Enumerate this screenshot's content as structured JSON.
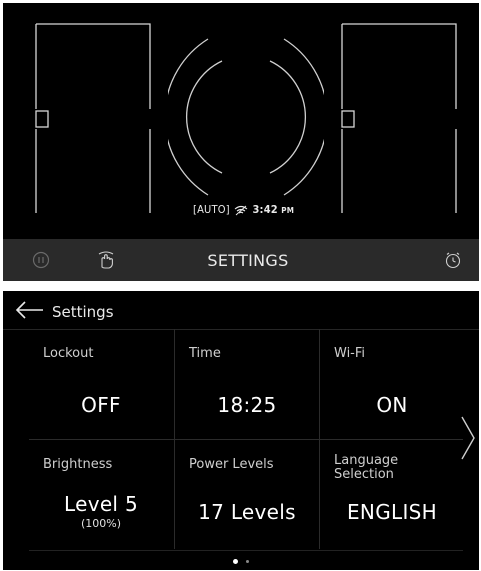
{
  "cooktop": {
    "status": {
      "auto": "AUTO",
      "time": "3:42",
      "ampm": "PM"
    },
    "bar": {
      "settings_label": "SETTINGS"
    }
  },
  "settings_screen": {
    "title": "Settings",
    "tiles": [
      {
        "label": "Lockout",
        "value": "OFF",
        "sub": ""
      },
      {
        "label": "Time",
        "value": "18:25",
        "sub": ""
      },
      {
        "label": "Wi-Fi",
        "value": "ON",
        "sub": ""
      },
      {
        "label": "Brightness",
        "value": "Level 5",
        "sub": "(100%)"
      },
      {
        "label": "Power Levels",
        "value": "17 Levels",
        "sub": ""
      },
      {
        "label": "Language Selection",
        "value": "ENGLISH",
        "sub": ""
      }
    ],
    "page_indicator": {
      "current": 1,
      "total": 2
    }
  },
  "colors": {
    "background": "#000000",
    "bar": "#2a2a2a",
    "text": "#ffffff",
    "divider": "#2b2b2b"
  },
  "icons": [
    "pause-icon",
    "touch-icon",
    "timer-icon",
    "back-arrow-icon",
    "chevron-right-icon",
    "wifi-icon"
  ]
}
